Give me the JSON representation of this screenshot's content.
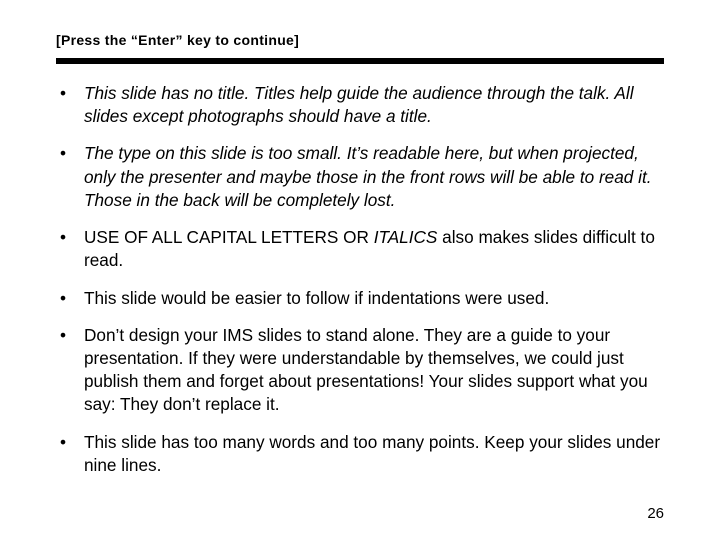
{
  "instruction": "[Press the “Enter” key to continue]",
  "bullets": [
    {
      "runs": [
        {
          "t": "This slide has no title.  Titles help guide the audience through the talk.  All slides except photographs should have a title.",
          "s": "ital"
        }
      ]
    },
    {
      "runs": [
        {
          "t": "The type on this slide is too small.  It’s readable here, but when projected, only the presenter and maybe those in the front rows will be able to read it.  Those in the back will be completely lost.",
          "s": "ital"
        }
      ]
    },
    {
      "runs": [
        {
          "t": "USE OF ALL CAPITAL LETTERS OR ",
          "s": ""
        },
        {
          "t": "ITALICS",
          "s": "ital"
        },
        {
          "t": "  also makes slides difficult to read.",
          "s": ""
        }
      ]
    },
    {
      "runs": [
        {
          "t": "This slide would be easier to follow if indentations were used.",
          "s": ""
        }
      ]
    },
    {
      "runs": [
        {
          "t": "Don’t design your IMS slides to stand alone.  They are a guide to your presentation.  If they were understandable by themselves, we could just publish them and forget about presentations!  Your slides support what you say:  They don’t replace it.",
          "s": ""
        }
      ]
    },
    {
      "runs": [
        {
          "t": "This slide has too many words and too many points.  Keep your slides under nine lines.",
          "s": ""
        }
      ]
    }
  ],
  "page_number": "26"
}
